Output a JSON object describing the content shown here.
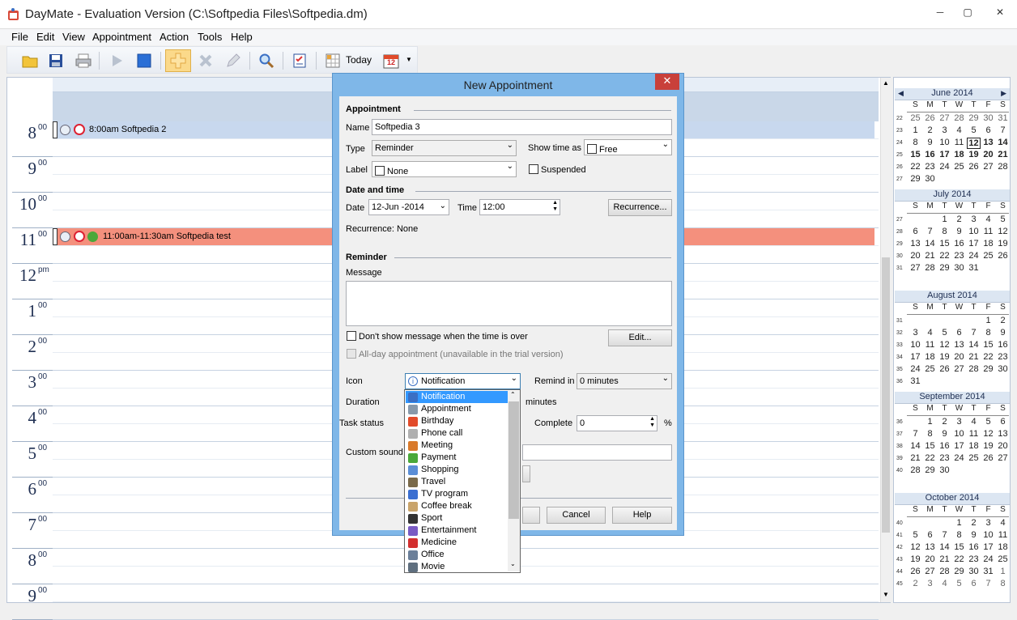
{
  "window": {
    "title": "DayMate - Evaluation Version (C:\\Softpedia Files\\Softpedia.dm)",
    "minimize": "─",
    "maximize": "▢",
    "close": "✕"
  },
  "menu": [
    "File",
    "Edit",
    "View",
    "Appointment",
    "Action",
    "Tools",
    "Help"
  ],
  "toolbar": {
    "today_label": "Today",
    "calendar_badge": "12"
  },
  "hours": [
    {
      "h": "8",
      "m": "00"
    },
    {
      "h": "9",
      "m": "00"
    },
    {
      "h": "10",
      "m": "00"
    },
    {
      "h": "11",
      "m": "00"
    },
    {
      "h": "12",
      "m": "pm"
    },
    {
      "h": "1",
      "m": "00"
    },
    {
      "h": "2",
      "m": "00"
    },
    {
      "h": "3",
      "m": "00"
    },
    {
      "h": "4",
      "m": "00"
    },
    {
      "h": "5",
      "m": "00"
    },
    {
      "h": "6",
      "m": "00"
    },
    {
      "h": "7",
      "m": "00"
    },
    {
      "h": "8",
      "m": "00"
    },
    {
      "h": "9",
      "m": "00"
    }
  ],
  "appointments": [
    {
      "text": "8:00am Softpedia 2",
      "color": "#c8d8ee"
    },
    {
      "text": "11:00am-11:30am Softpedia test",
      "color": "#f4907d"
    }
  ],
  "calendar": {
    "dow": [
      "S",
      "M",
      "T",
      "W",
      "T",
      "F",
      "S"
    ],
    "months": [
      {
        "name": "June 2014",
        "weeks": [
          "22",
          "23",
          "24",
          "25",
          "26",
          "27"
        ],
        "days": [
          [
            "25",
            "26",
            "27",
            "28",
            "29",
            "30",
            "31"
          ],
          [
            "1",
            "2",
            "3",
            "4",
            "5",
            "6",
            "7"
          ],
          [
            "8",
            "9",
            "10",
            "11",
            "12",
            "13",
            "14"
          ],
          [
            "15",
            "16",
            "17",
            "18",
            "19",
            "20",
            "21"
          ],
          [
            "22",
            "23",
            "24",
            "25",
            "26",
            "27",
            "28"
          ],
          [
            "29",
            "30",
            "",
            "",
            "",
            "",
            ""
          ]
        ]
      },
      {
        "name": "July 2014",
        "weeks": [
          "27",
          "28",
          "29",
          "30",
          "31"
        ],
        "days": [
          [
            "",
            "",
            "1",
            "2",
            "3",
            "4",
            "5"
          ],
          [
            "6",
            "7",
            "8",
            "9",
            "10",
            "11",
            "12"
          ],
          [
            "13",
            "14",
            "15",
            "16",
            "17",
            "18",
            "19"
          ],
          [
            "20",
            "21",
            "22",
            "23",
            "24",
            "25",
            "26"
          ],
          [
            "27",
            "28",
            "29",
            "30",
            "31",
            "",
            ""
          ]
        ]
      },
      {
        "name": "August 2014",
        "weeks": [
          "31",
          "32",
          "33",
          "34",
          "35",
          "36"
        ],
        "days": [
          [
            "",
            "",
            "",
            "",
            "",
            "1",
            "2"
          ],
          [
            "3",
            "4",
            "5",
            "6",
            "7",
            "8",
            "9"
          ],
          [
            "10",
            "11",
            "12",
            "13",
            "14",
            "15",
            "16"
          ],
          [
            "17",
            "18",
            "19",
            "20",
            "21",
            "22",
            "23"
          ],
          [
            "24",
            "25",
            "26",
            "27",
            "28",
            "29",
            "30"
          ],
          [
            "31",
            "",
            "",
            "",
            "",
            "",
            ""
          ]
        ]
      },
      {
        "name": "September 2014",
        "weeks": [
          "36",
          "37",
          "38",
          "39",
          "40"
        ],
        "days": [
          [
            "",
            "1",
            "2",
            "3",
            "4",
            "5",
            "6"
          ],
          [
            "7",
            "8",
            "9",
            "10",
            "11",
            "12",
            "13"
          ],
          [
            "14",
            "15",
            "16",
            "17",
            "18",
            "19",
            "20"
          ],
          [
            "21",
            "22",
            "23",
            "24",
            "25",
            "26",
            "27"
          ],
          [
            "28",
            "29",
            "30",
            "",
            "",
            "",
            ""
          ]
        ]
      },
      {
        "name": "October 2014",
        "weeks": [
          "40",
          "41",
          "42",
          "43",
          "44",
          "45"
        ],
        "days": [
          [
            "",
            "",
            "",
            "1",
            "2",
            "3",
            "4"
          ],
          [
            "5",
            "6",
            "7",
            "8",
            "9",
            "10",
            "11"
          ],
          [
            "12",
            "13",
            "14",
            "15",
            "16",
            "17",
            "18"
          ],
          [
            "19",
            "20",
            "21",
            "22",
            "23",
            "24",
            "25"
          ],
          [
            "26",
            "27",
            "28",
            "29",
            "30",
            "31",
            "1"
          ],
          [
            "2",
            "3",
            "4",
            "5",
            "6",
            "7",
            "8"
          ]
        ]
      }
    ]
  },
  "dialog": {
    "title": "New Appointment",
    "close": "✕",
    "appointment_section": "Appointment",
    "name_label": "Name",
    "name_value": "Softpedia 3",
    "type_label": "Type",
    "type_value": "Reminder",
    "showtime_label": "Show time as",
    "showtime_value": "Free",
    "label_label": "Label",
    "label_value": "None",
    "suspended_label": "Suspended",
    "datetime_section": "Date and time",
    "date_label": "Date",
    "date_value": "12-Jun -2014",
    "time_label": "Time",
    "time_value": "12:00",
    "recurrence_button": "Recurrence...",
    "recurrence_text": "Recurrence: None",
    "reminder_section": "Reminder",
    "message_label": "Message",
    "dont_show_label": "Don't show message when the time is over",
    "edit_button": "Edit...",
    "allday_label": "All-day appointment (unavailable in the trial version)",
    "icon_label": "Icon",
    "icon_value": "Notification",
    "remind_label": "Remind in",
    "remind_value": "0 minutes",
    "duration_label": "Duration",
    "minutes_label": "minutes",
    "task_status_label": "Task status",
    "complete_label": "Complete",
    "complete_value": "0",
    "percent": "%",
    "custom_sound_label": "Custom sound",
    "cancel_button": "Cancel",
    "help_button": "Help"
  },
  "icon_dropdown": [
    {
      "label": "Notification",
      "color": "#3a6fc4"
    },
    {
      "label": "Appointment",
      "color": "#8899aa"
    },
    {
      "label": "Birthday",
      "color": "#e24b2a"
    },
    {
      "label": "Phone call",
      "color": "#b0b0b0"
    },
    {
      "label": "Meeting",
      "color": "#d97a2b"
    },
    {
      "label": "Payment",
      "color": "#4aa83a"
    },
    {
      "label": "Shopping",
      "color": "#5b8ed6"
    },
    {
      "label": "Travel",
      "color": "#7a6a4a"
    },
    {
      "label": "TV program",
      "color": "#3b6fd1"
    },
    {
      "label": "Coffee break",
      "color": "#c9a46b"
    },
    {
      "label": "Sport",
      "color": "#333333"
    },
    {
      "label": "Entertainment",
      "color": "#7a5bc4"
    },
    {
      "label": "Medicine",
      "color": "#d32f2f"
    },
    {
      "label": "Office",
      "color": "#6b7f99"
    },
    {
      "label": "Movie",
      "color": "#5f6f7f"
    }
  ]
}
